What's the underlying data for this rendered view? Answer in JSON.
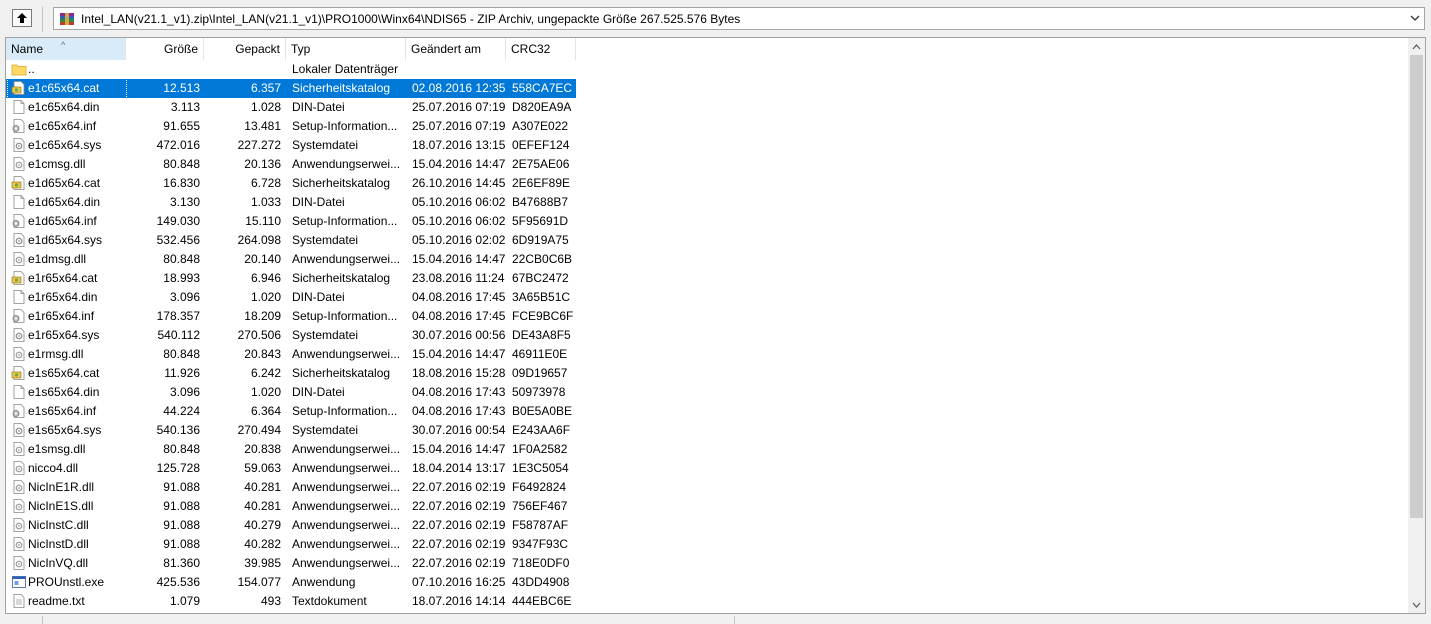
{
  "address": {
    "path": "Intel_LAN(v21.1_v1).zip\\Intel_LAN(v21.1_v1)\\PRO1000\\Winx64\\NDIS65 - ZIP Archiv, ungepackte Größe 267.525.576 Bytes"
  },
  "columns": {
    "name": "Name",
    "size": "Größe",
    "packed": "Gepackt",
    "type": "Typ",
    "modified": "Geändert am",
    "crc": "CRC32"
  },
  "files": [
    {
      "name": "..",
      "size": "",
      "packed": "",
      "type": "Lokaler Datenträger",
      "modified": "",
      "crc": "",
      "icon": "folder-icon"
    },
    {
      "name": "e1c65x64.cat",
      "size": "12.513",
      "packed": "6.357",
      "type": "Sicherheitskatalog",
      "modified": "02.08.2016 12:35",
      "crc": "558CA7EC",
      "icon": "catalog-icon",
      "selected": true
    },
    {
      "name": "e1c65x64.din",
      "size": "3.113",
      "packed": "1.028",
      "type": "DIN-Datei",
      "modified": "25.07.2016 07:19",
      "crc": "D820EA9A",
      "icon": "blank-file-icon"
    },
    {
      "name": "e1c65x64.inf",
      "size": "91.655",
      "packed": "13.481",
      "type": "Setup-Information...",
      "modified": "25.07.2016 07:19",
      "crc": "A307E022",
      "icon": "setup-file-icon"
    },
    {
      "name": "e1c65x64.sys",
      "size": "472.016",
      "packed": "227.272",
      "type": "Systemdatei",
      "modified": "18.07.2016 13:15",
      "crc": "0EFEF124",
      "icon": "system-file-icon"
    },
    {
      "name": "e1cmsg.dll",
      "size": "80.848",
      "packed": "20.136",
      "type": "Anwendungserwei...",
      "modified": "15.04.2016 14:47",
      "crc": "2E75AE06",
      "icon": "dll-file-icon"
    },
    {
      "name": "e1d65x64.cat",
      "size": "16.830",
      "packed": "6.728",
      "type": "Sicherheitskatalog",
      "modified": "26.10.2016 14:45",
      "crc": "2E6EF89E",
      "icon": "catalog-icon"
    },
    {
      "name": "e1d65x64.din",
      "size": "3.130",
      "packed": "1.033",
      "type": "DIN-Datei",
      "modified": "05.10.2016 06:02",
      "crc": "B47688B7",
      "icon": "blank-file-icon"
    },
    {
      "name": "e1d65x64.inf",
      "size": "149.030",
      "packed": "15.110",
      "type": "Setup-Information...",
      "modified": "05.10.2016 06:02",
      "crc": "5F95691D",
      "icon": "setup-file-icon"
    },
    {
      "name": "e1d65x64.sys",
      "size": "532.456",
      "packed": "264.098",
      "type": "Systemdatei",
      "modified": "05.10.2016 02:02",
      "crc": "6D919A75",
      "icon": "system-file-icon"
    },
    {
      "name": "e1dmsg.dll",
      "size": "80.848",
      "packed": "20.140",
      "type": "Anwendungserwei...",
      "modified": "15.04.2016 14:47",
      "crc": "22CB0C6B",
      "icon": "dll-file-icon"
    },
    {
      "name": "e1r65x64.cat",
      "size": "18.993",
      "packed": "6.946",
      "type": "Sicherheitskatalog",
      "modified": "23.08.2016 11:24",
      "crc": "67BC2472",
      "icon": "catalog-icon"
    },
    {
      "name": "e1r65x64.din",
      "size": "3.096",
      "packed": "1.020",
      "type": "DIN-Datei",
      "modified": "04.08.2016 17:45",
      "crc": "3A65B51C",
      "icon": "blank-file-icon"
    },
    {
      "name": "e1r65x64.inf",
      "size": "178.357",
      "packed": "18.209",
      "type": "Setup-Information...",
      "modified": "04.08.2016 17:45",
      "crc": "FCE9BC6F",
      "icon": "setup-file-icon"
    },
    {
      "name": "e1r65x64.sys",
      "size": "540.112",
      "packed": "270.506",
      "type": "Systemdatei",
      "modified": "30.07.2016 00:56",
      "crc": "DE43A8F5",
      "icon": "system-file-icon"
    },
    {
      "name": "e1rmsg.dll",
      "size": "80.848",
      "packed": "20.843",
      "type": "Anwendungserwei...",
      "modified": "15.04.2016 14:47",
      "crc": "46911E0E",
      "icon": "dll-file-icon"
    },
    {
      "name": "e1s65x64.cat",
      "size": "11.926",
      "packed": "6.242",
      "type": "Sicherheitskatalog",
      "modified": "18.08.2016 15:28",
      "crc": "09D19657",
      "icon": "catalog-icon"
    },
    {
      "name": "e1s65x64.din",
      "size": "3.096",
      "packed": "1.020",
      "type": "DIN-Datei",
      "modified": "04.08.2016 17:43",
      "crc": "50973978",
      "icon": "blank-file-icon"
    },
    {
      "name": "e1s65x64.inf",
      "size": "44.224",
      "packed": "6.364",
      "type": "Setup-Information...",
      "modified": "04.08.2016 17:43",
      "crc": "B0E5A0BE",
      "icon": "setup-file-icon"
    },
    {
      "name": "e1s65x64.sys",
      "size": "540.136",
      "packed": "270.494",
      "type": "Systemdatei",
      "modified": "30.07.2016 00:54",
      "crc": "E243AA6F",
      "icon": "system-file-icon"
    },
    {
      "name": "e1smsg.dll",
      "size": "80.848",
      "packed": "20.838",
      "type": "Anwendungserwei...",
      "modified": "15.04.2016 14:47",
      "crc": "1F0A2582",
      "icon": "dll-file-icon"
    },
    {
      "name": "nicco4.dll",
      "size": "125.728",
      "packed": "59.063",
      "type": "Anwendungserwei...",
      "modified": "18.04.2014 13:17",
      "crc": "1E3C5054",
      "icon": "dll-file-icon"
    },
    {
      "name": "NicInE1R.dll",
      "size": "91.088",
      "packed": "40.281",
      "type": "Anwendungserwei...",
      "modified": "22.07.2016 02:19",
      "crc": "F6492824",
      "icon": "dll-file-icon"
    },
    {
      "name": "NicInE1S.dll",
      "size": "91.088",
      "packed": "40.281",
      "type": "Anwendungserwei...",
      "modified": "22.07.2016 02:19",
      "crc": "756EF467",
      "icon": "dll-file-icon"
    },
    {
      "name": "NicInstC.dll",
      "size": "91.088",
      "packed": "40.279",
      "type": "Anwendungserwei...",
      "modified": "22.07.2016 02:19",
      "crc": "F58787AF",
      "icon": "dll-file-icon"
    },
    {
      "name": "NicInstD.dll",
      "size": "91.088",
      "packed": "40.282",
      "type": "Anwendungserwei...",
      "modified": "22.07.2016 02:19",
      "crc": "9347F93C",
      "icon": "dll-file-icon"
    },
    {
      "name": "NicInVQ.dll",
      "size": "81.360",
      "packed": "39.985",
      "type": "Anwendungserwei...",
      "modified": "22.07.2016 02:19",
      "crc": "718E0DF0",
      "icon": "dll-file-icon"
    },
    {
      "name": "PROUnstl.exe",
      "size": "425.536",
      "packed": "154.077",
      "type": "Anwendung",
      "modified": "07.10.2016 16:25",
      "crc": "43DD4908",
      "icon": "exe-file-icon"
    },
    {
      "name": "readme.txt",
      "size": "1.079",
      "packed": "493",
      "type": "Textdokument",
      "modified": "18.07.2016 14:14",
      "crc": "444EBC6E",
      "icon": "text-file-icon"
    }
  ],
  "colors": {
    "selection": "#0078d7",
    "sorted_header": "#d9ebf9",
    "folder": "#ffd966"
  }
}
